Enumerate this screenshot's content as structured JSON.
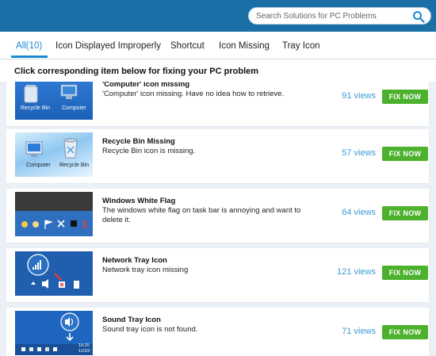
{
  "search": {
    "placeholder": "Search Solutions for PC Problems"
  },
  "tabs": [
    {
      "label": "All(10)",
      "active": true
    },
    {
      "label": "Icon Displayed Improperly"
    },
    {
      "label": "Shortcut"
    },
    {
      "label": "Icon Missing"
    },
    {
      "label": "Tray Icon"
    }
  ],
  "instruction": "Click corresponding item below for fixing your PC problem",
  "items": [
    {
      "title": "'Computer' icon missing",
      "description": "'Computer' icon missing. Have no idea how to retrieve.",
      "views": "91 views",
      "button": "FIX NOW",
      "thumb_labels": [
        "Recycle Bin",
        "Computer"
      ]
    },
    {
      "title": "Recycle Bin Missing",
      "description": "Recycle Bin icon is missing.",
      "views": "57 views",
      "button": "FIX NOW",
      "thumb_labels": [
        "Computer",
        "Recycle Bin"
      ]
    },
    {
      "title": "Windows White Flag",
      "description": "The windows white flag on task bar is annoying and want to delete it.",
      "views": "64 views",
      "button": "FIX NOW"
    },
    {
      "title": "Network Tray Icon",
      "description": "Network tray icon missing",
      "views": "121 views",
      "button": "FIX NOW"
    },
    {
      "title": "Sound Tray Icon",
      "description": "Sound tray icon is not found.",
      "views": "71 views",
      "button": "FIX NOW",
      "thumb_labels": [
        "10:25",
        "11/10/"
      ]
    }
  ],
  "colors": {
    "header": "#1a6fa7",
    "accent": "#1a8ad4",
    "fix_button": "#4cb12d",
    "views": "#3b9ad6"
  },
  "icons": {
    "search": "magnifier-icon"
  }
}
